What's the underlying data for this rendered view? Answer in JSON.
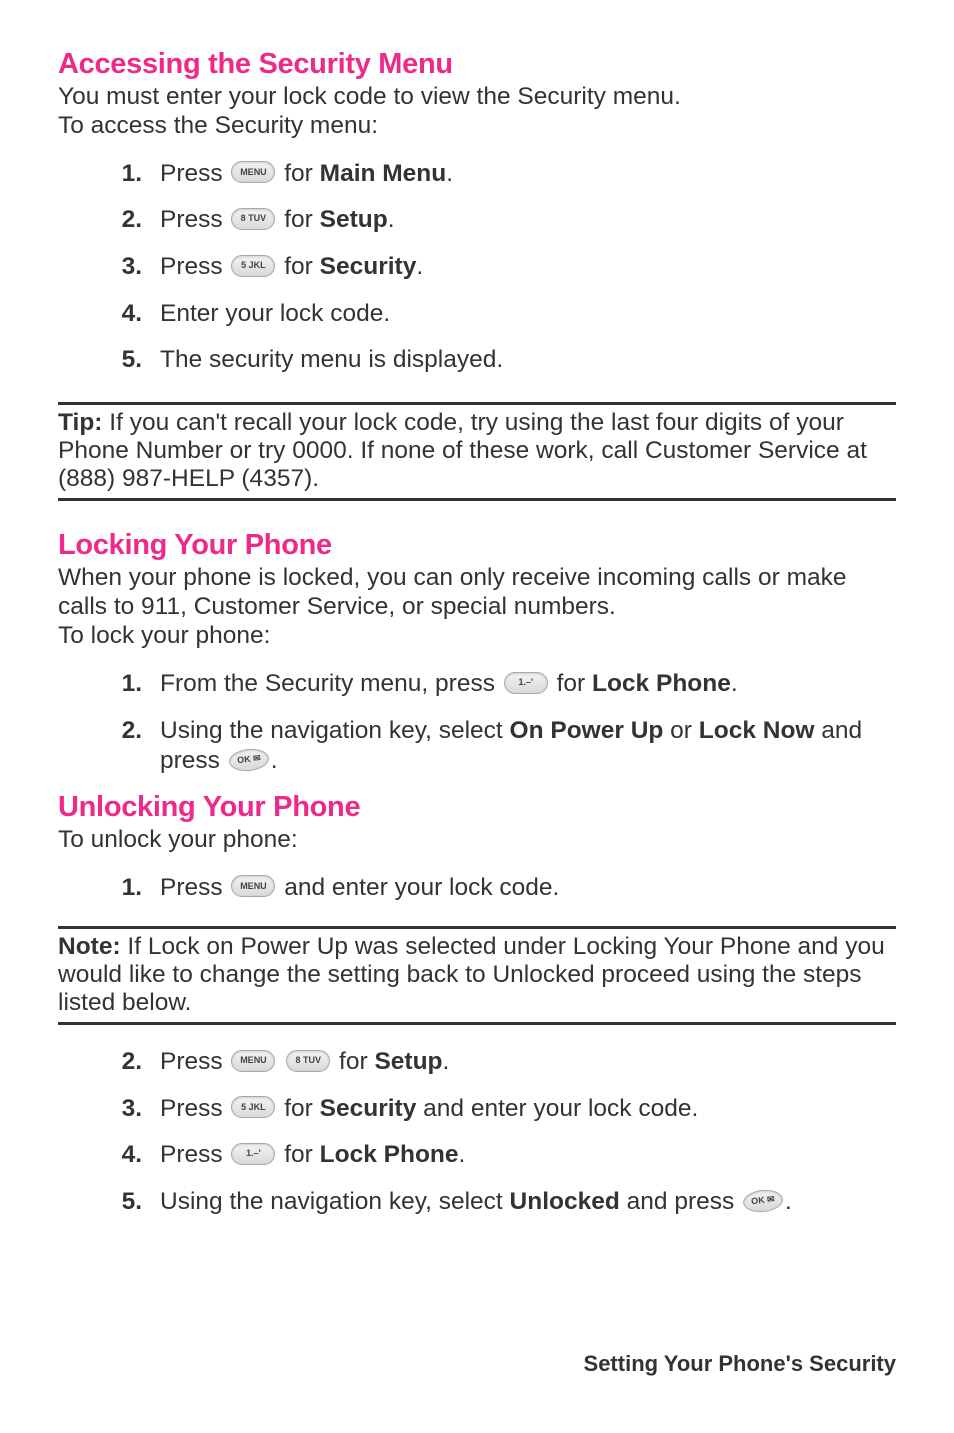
{
  "section1": {
    "heading": "Accessing the Security Menu",
    "intro_line1": "You must enter your lock code to view the Security menu.",
    "intro_line2": "To access the Security menu:",
    "steps": {
      "s1": {
        "num": "1.",
        "pre": "Press ",
        "key": "MENU",
        "mid": " for ",
        "bold": "Main Menu",
        "post": "."
      },
      "s2": {
        "num": "2.",
        "pre": "Press ",
        "key": "8 TUV",
        "mid": " for ",
        "bold": "Setup",
        "post": "."
      },
      "s3": {
        "num": "3.",
        "pre": "Press ",
        "key": "5 JKL",
        "mid": " for ",
        "bold": "Security",
        "post": "."
      },
      "s4": {
        "num": "4.",
        "text": "Enter your lock code."
      },
      "s5": {
        "num": "5.",
        "text": "The security menu is displayed."
      }
    }
  },
  "callout1": {
    "lead": "Tip:",
    "text": " If you can't recall your lock code, try using the last four digits of your Phone Number or try 0000. If none of these work, call Customer Service at (888) 987-HELP (4357)."
  },
  "section2": {
    "heading": "Locking Your Phone",
    "intro_line1": "When your phone is locked, you can only receive incoming calls or make calls to 911, Customer Service, or special numbers.",
    "intro_line2": "To lock your phone:",
    "steps": {
      "s1": {
        "num": "1.",
        "pre": "From the Security menu, press ",
        "key": "1.–'",
        "mid": " for ",
        "bold": "Lock Phone",
        "post": "."
      },
      "s2": {
        "num": "2.",
        "pre": "Using the navigation key, select ",
        "bold1": "On Power Up",
        "mid": " or ",
        "bold2": "Lock Now",
        "post1": " and press ",
        "key": "OK ✉",
        "post2": "."
      }
    }
  },
  "section3": {
    "heading": "Unlocking Your Phone",
    "intro": "To unlock your phone:",
    "steps": {
      "s1": {
        "num": "1.",
        "pre": "Press ",
        "key": "MENU",
        "post": " and enter your lock code."
      }
    }
  },
  "callout2": {
    "lead": "Note:",
    "text": " If Lock on Power Up was selected under Locking Your Phone and you would like to change the setting back to Unlocked proceed using the steps listed below."
  },
  "section4": {
    "steps": {
      "s2": {
        "num": "2.",
        "pre": "Press ",
        "key1": "MENU",
        "key2": "8 TUV",
        "mid": " for ",
        "bold": "Setup",
        "post": "."
      },
      "s3": {
        "num": "3.",
        "pre": "Press ",
        "key": "5 JKL",
        "mid": " for ",
        "bold": "Security",
        "post": " and enter your lock code."
      },
      "s4": {
        "num": "4.",
        "pre": "Press ",
        "key": "1.–'",
        "mid": " for ",
        "bold": "Lock Phone",
        "post": "."
      },
      "s5": {
        "num": "5.",
        "pre": "Using the navigation key, select ",
        "bold": "Unlocked",
        "post1": " and press ",
        "key": "OK ✉",
        "post2": "."
      }
    }
  },
  "footer": "Setting Your Phone's Security"
}
